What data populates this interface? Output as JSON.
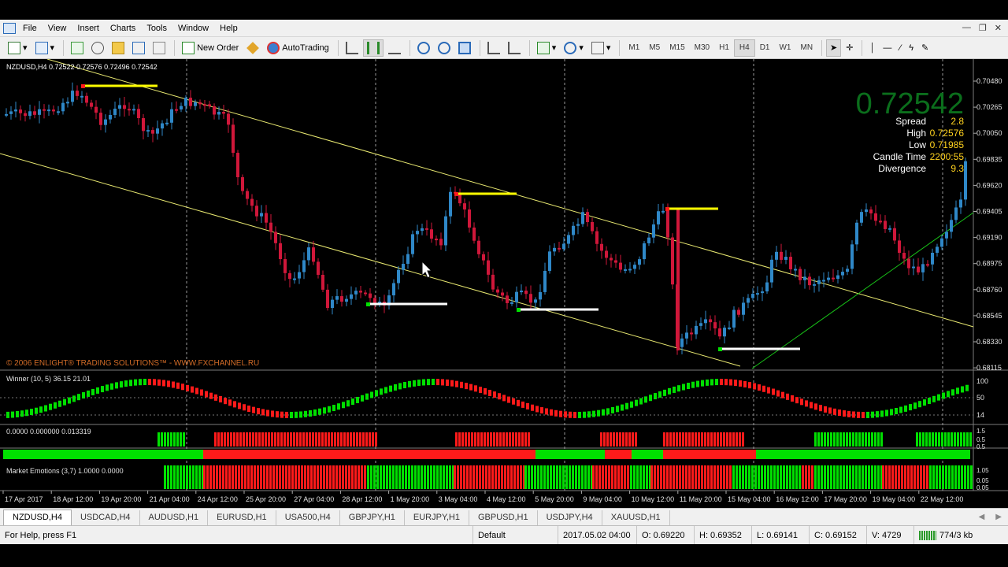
{
  "menu": [
    "File",
    "View",
    "Insert",
    "Charts",
    "Tools",
    "Window",
    "Help"
  ],
  "toolbar": {
    "new_order": "New Order",
    "autotrading": "AutoTrading",
    "timeframes": [
      "M1",
      "M5",
      "M15",
      "M30",
      "H1",
      "H4",
      "D1",
      "W1",
      "MN"
    ],
    "active_timeframe": "H4"
  },
  "chart": {
    "header": "NZDUSD,H4  0.72522 0.72576 0.72496 0.72542",
    "copyright": "© 2006 ENLIGHT® TRADING SOLUTIONS™ - WWW.FXCHANNEL.RU",
    "big_price": "0.72542",
    "info": [
      {
        "label": "Spread",
        "value": "2.8"
      },
      {
        "label": "High",
        "value": "0.72576"
      },
      {
        "label": "Low",
        "value": "0.71985"
      },
      {
        "label": "Candle Time",
        "value": "2200:55"
      },
      {
        "label": "Divergence",
        "value": "9.3"
      }
    ],
    "price_scale": [
      "0.70480",
      "0.70265",
      "0.70050",
      "0.69835",
      "0.69620",
      "0.69405",
      "0.69190",
      "0.68975",
      "0.68760",
      "0.68545",
      "0.68330",
      "0.68115"
    ],
    "winner_label": "Winner (10, 5)  36.15 21.01",
    "winner_scale": [
      "100",
      "50",
      "14"
    ],
    "trend_label": "0.0000 0.000000 0.013319",
    "trend_scale": [
      "1.5",
      "0.5",
      "0.5"
    ],
    "emotions_label": "Market Emotions (3,7) 1.0000 0.0000",
    "emotions_scale": [
      "1.05",
      "0.05",
      "0.05"
    ],
    "time_axis": [
      "17 Apr 2017",
      "18 Apr 12:00",
      "19 Apr 20:00",
      "21 Apr 04:00",
      "24 Apr 12:00",
      "25 Apr 20:00",
      "27 Apr 04:00",
      "28 Apr 12:00",
      "1 May 20:00",
      "3 May 04:00",
      "4 May 12:00",
      "5 May 20:00",
      "9 May 04:00",
      "10 May 12:00",
      "11 May 20:00",
      "15 May 04:00",
      "16 May 12:00",
      "17 May 20:00",
      "19 May 04:00",
      "22 May 12:00"
    ]
  },
  "symbol_tabs": [
    "NZDUSD,H4",
    "USDCAD,H4",
    "AUDUSD,H1",
    "EURUSD,H1",
    "USA500,H4",
    "GBPJPY,H1",
    "EURJPY,H1",
    "GBPUSD,H1",
    "USDJPY,H4",
    "XAUUSD,H1"
  ],
  "active_tab": "NZDUSD,H4",
  "status": {
    "help": "For Help, press F1",
    "profile": "Default",
    "datetime": "2017.05.02 04:00",
    "open": "O: 0.69220",
    "high": "H: 0.69352",
    "low": "L: 0.69141",
    "close": "C: 0.69152",
    "volume": "V: 4729",
    "traffic": "774/3 kb"
  },
  "colors": {
    "bull": "#2f88c8",
    "bear": "#d0173a",
    "green": "#00e000",
    "red": "#ff1a1a",
    "yellow": "#ffff00",
    "price_green": "#0b6e1c"
  }
}
